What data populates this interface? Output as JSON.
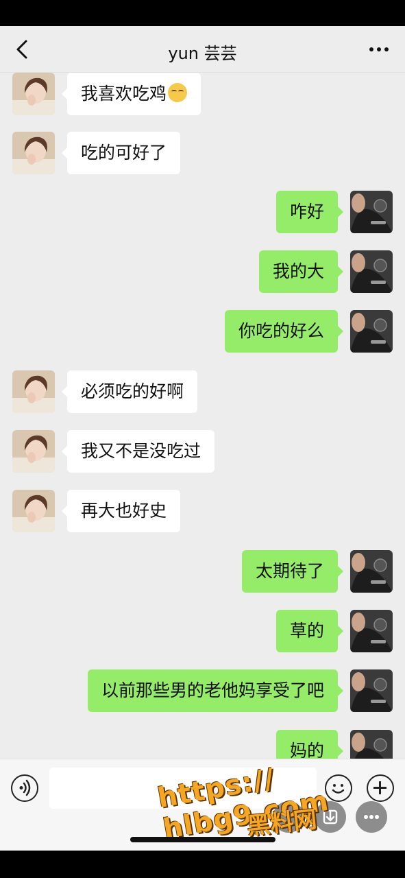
{
  "header": {
    "title": "yun 芸芸"
  },
  "messages": [
    {
      "side": "left",
      "text": "我喜欢吃鸡",
      "emoji": true
    },
    {
      "side": "left",
      "text": "吃的可好了"
    },
    {
      "side": "right",
      "text": "咋好"
    },
    {
      "side": "right",
      "text": "我的大"
    },
    {
      "side": "right",
      "text": "你吃的好么"
    },
    {
      "side": "left",
      "text": "必须吃的好啊"
    },
    {
      "side": "left",
      "text": "我又不是没吃过"
    },
    {
      "side": "left",
      "text": "再大也好史"
    },
    {
      "side": "right",
      "text": "太期待了"
    },
    {
      "side": "right",
      "text": "草的"
    },
    {
      "side": "right",
      "text": "以前那些男的老他妈享受了吧"
    },
    {
      "side": "right",
      "text": "妈的"
    }
  ],
  "watermark": {
    "url": "https:// hlbg9.com",
    "name": "黑料网"
  },
  "colors": {
    "bubble_right": "#95ec69",
    "bubble_left": "#ffffff",
    "background": "#ededed"
  }
}
